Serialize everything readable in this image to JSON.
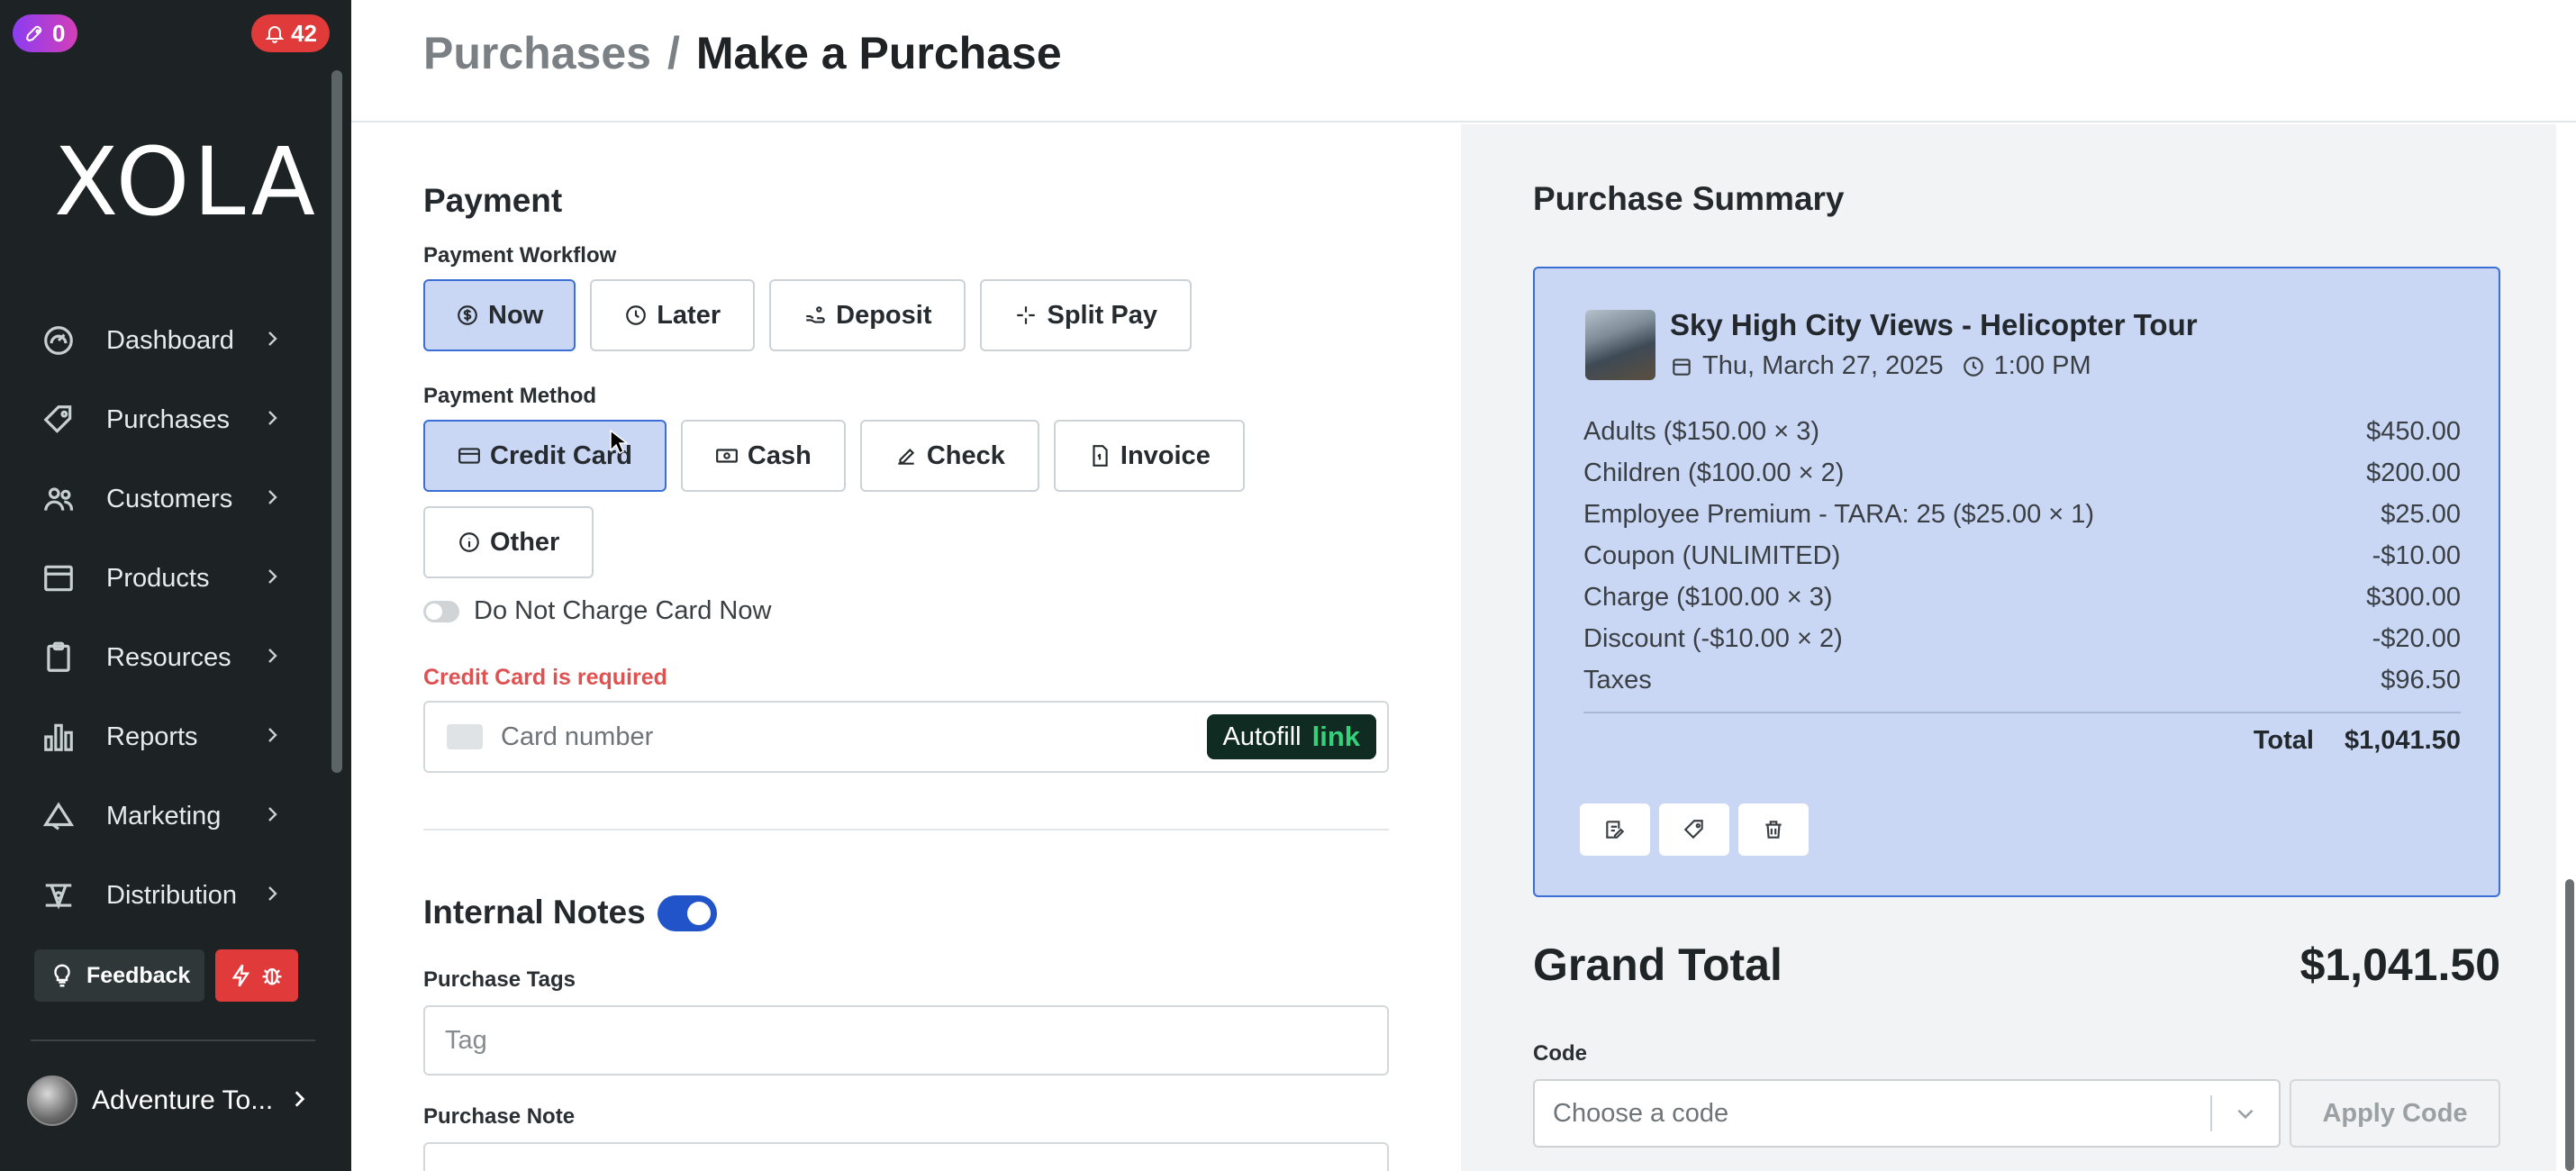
{
  "sidebar": {
    "badge_left": "0",
    "badge_right": "42",
    "logo": "XOLA",
    "items": [
      {
        "label": "Dashboard",
        "icon": "dashboard-gauge-icon"
      },
      {
        "label": "Purchases",
        "icon": "purchases-tag-icon"
      },
      {
        "label": "Customers",
        "icon": "customers-people-icon"
      },
      {
        "label": "Products",
        "icon": "products-box-icon"
      },
      {
        "label": "Resources",
        "icon": "resources-clipboard-icon"
      },
      {
        "label": "Reports",
        "icon": "reports-bar-icon"
      },
      {
        "label": "Marketing",
        "icon": "marketing-megaphone-icon"
      },
      {
        "label": "Distribution",
        "icon": "distribution-network-icon"
      }
    ],
    "feedback_label": "Feedback",
    "account_name": "Adventure To..."
  },
  "header": {
    "crumb_parent": "Purchases",
    "crumb_sep": "/",
    "crumb_current": "Make a Purchase"
  },
  "payment": {
    "title": "Payment",
    "workflow_label": "Payment Workflow",
    "workflow_options": [
      "Now",
      "Later",
      "Deposit",
      "Split Pay"
    ],
    "workflow_selected": "Now",
    "method_label": "Payment Method",
    "method_options": [
      "Credit Card",
      "Cash",
      "Check",
      "Invoice",
      "Other"
    ],
    "method_selected": "Credit Card",
    "do_not_charge_label": "Do Not Charge Card Now",
    "error": "Credit Card is required",
    "card_placeholder": "Card number",
    "autofill_label": "Autofill",
    "autofill_link": "link"
  },
  "notes": {
    "title": "Internal Notes",
    "tags_label": "Purchase Tags",
    "tags_placeholder": "Tag",
    "note_label": "Purchase Note"
  },
  "summary": {
    "title": "Purchase Summary",
    "tour_title": "Sky High City Views - Helicopter Tour",
    "date": "Thu, March 27, 2025",
    "time": "1:00 PM",
    "lines": [
      {
        "label": "Adults ($150.00 × 3)",
        "amount": "$450.00"
      },
      {
        "label": "Children ($100.00 × 2)",
        "amount": "$200.00"
      },
      {
        "label": "Employee Premium - TARA: 25 ($25.00 × 1)",
        "amount": "$25.00"
      },
      {
        "label": "Coupon (UNLIMITED)",
        "amount": "-$10.00"
      },
      {
        "label": "Charge ($100.00 × 3)",
        "amount": "$300.00"
      },
      {
        "label": "Discount (-$10.00 × 2)",
        "amount": "-$20.00"
      },
      {
        "label": "Taxes",
        "amount": "$96.50"
      }
    ],
    "total_label": "Total",
    "total_value": "$1,041.50",
    "grand_total_label": "Grand Total",
    "grand_total_value": "$1,041.50",
    "code_label": "Code",
    "code_placeholder": "Choose a code",
    "apply_label": "Apply Code"
  }
}
